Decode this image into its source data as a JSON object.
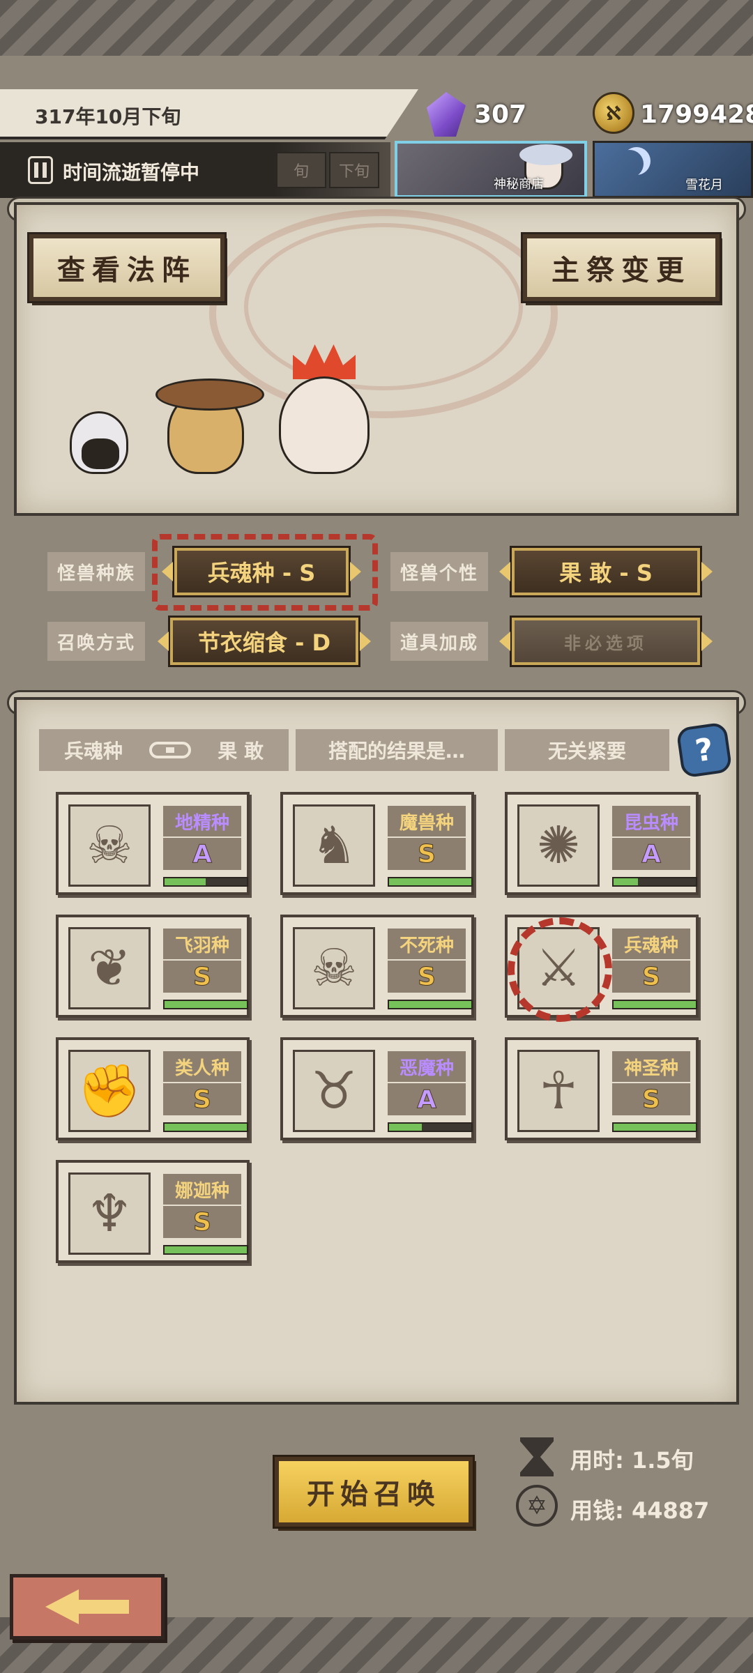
{
  "header": {
    "date": "317年10月下旬",
    "crystals": "307",
    "coins": "1799428",
    "coin_glyph": "ℵ",
    "status": "时间流逝暂停中",
    "mini_tabs": [
      "旬",
      "下旬"
    ],
    "shop_label": "神秘商店",
    "snow_label": "雪花月"
  },
  "top_panel": {
    "view_button": "查看法阵",
    "priest_button": "主祭变更"
  },
  "selectors": {
    "race_label": "怪兽种族",
    "race_value": "兵魂种 - S",
    "personality_label": "怪兽个性",
    "personality_value": "果 敢 - S",
    "summon_label": "召唤方式",
    "summon_value": "节衣缩食 - D",
    "item_label": "道具加成",
    "item_value": "非必选项"
  },
  "combo": {
    "left": "兵魂种",
    "right": "果 敢",
    "result": "搭配的结果是…",
    "verdict": "无关紧要",
    "help": "?"
  },
  "races": [
    {
      "name": "地精种",
      "grade": "A",
      "progress": 0.5,
      "icon": "goblin-skull-icon",
      "glyph": "☠",
      "color": "purple"
    },
    {
      "name": "魔兽种",
      "grade": "S",
      "progress": 1.0,
      "icon": "beast-icon",
      "glyph": "♞",
      "color": "gold"
    },
    {
      "name": "昆虫种",
      "grade": "A",
      "progress": 0.3,
      "icon": "insect-icon",
      "glyph": "✺",
      "color": "purple"
    },
    {
      "name": "飞羽种",
      "grade": "S",
      "progress": 1.0,
      "icon": "wings-icon",
      "glyph": "❦",
      "color": "gold"
    },
    {
      "name": "不死种",
      "grade": "S",
      "progress": 1.0,
      "icon": "undead-skull-icon",
      "glyph": "☠",
      "color": "gold"
    },
    {
      "name": "兵魂种",
      "grade": "S",
      "progress": 1.0,
      "icon": "sword-soul-icon",
      "glyph": "⚔",
      "color": "gold",
      "selected": true
    },
    {
      "name": "类人种",
      "grade": "S",
      "progress": 1.0,
      "icon": "fist-icon",
      "glyph": "✊",
      "color": "gold"
    },
    {
      "name": "恶魔种",
      "grade": "A",
      "progress": 0.4,
      "icon": "demon-icon",
      "glyph": "♉",
      "color": "purple"
    },
    {
      "name": "神圣种",
      "grade": "S",
      "progress": 1.0,
      "icon": "holy-halo-icon",
      "glyph": "☥",
      "color": "gold"
    },
    {
      "name": "娜迦种",
      "grade": "S",
      "progress": 1.0,
      "icon": "trident-icon",
      "glyph": "♆",
      "color": "gold"
    }
  ],
  "footer": {
    "start_button": "开始召唤",
    "time_cost": "用时: 1.5旬",
    "money_cost": "用钱: 44887",
    "pentagram_glyph": "✡"
  },
  "colors": {
    "accent_gold": "#f4d37e",
    "grade_purple": "#b98cff",
    "progress_green": "#77c15a",
    "selection_red": "#b6382c"
  }
}
